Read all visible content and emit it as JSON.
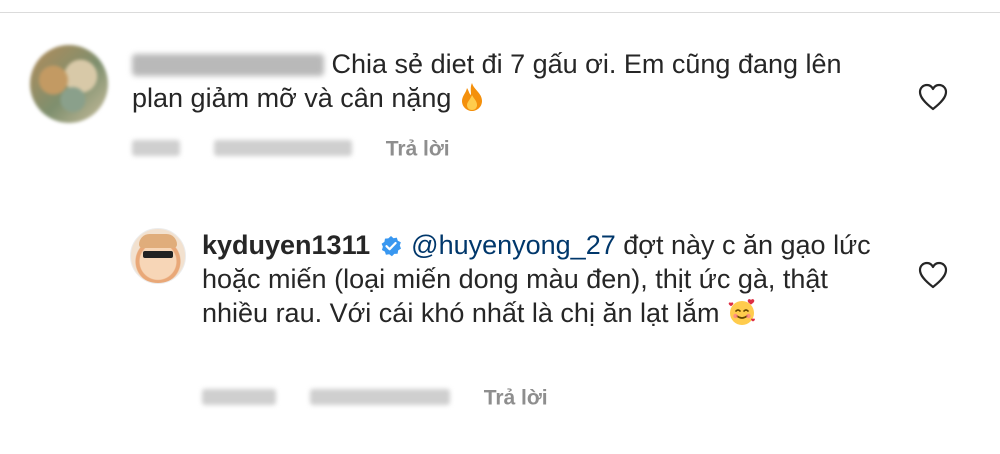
{
  "comments": [
    {
      "text_before_emoji": "Chia sẻ diet đi 7 gấu ơi. Em cũng đang lên plan giảm mỡ và cân nặng",
      "emoji": "fire-emoji",
      "reply_label": "Trả lời"
    },
    {
      "username": "kyduyen1311",
      "verified_badge_icon": "verified-badge-icon",
      "mention": "@huyenyong_27",
      "text": " đợt này c ăn gạo lức hoặc miến (loại miến dong màu đen), thịt ức gà, thật nhiều rau. Với cái khó nhất là chị ăn lạt lắm",
      "emoji": "smiling-face-with-hearts-emoji",
      "reply_label": "Trả lời"
    }
  ],
  "colors": {
    "text": "#262626",
    "meta": "#8e8e8e",
    "mention": "#00376b",
    "verified": "#3897f0"
  },
  "icons": [
    "heart-icon",
    "verified-badge-icon",
    "fire-emoji",
    "smiling-face-with-hearts-emoji"
  ]
}
